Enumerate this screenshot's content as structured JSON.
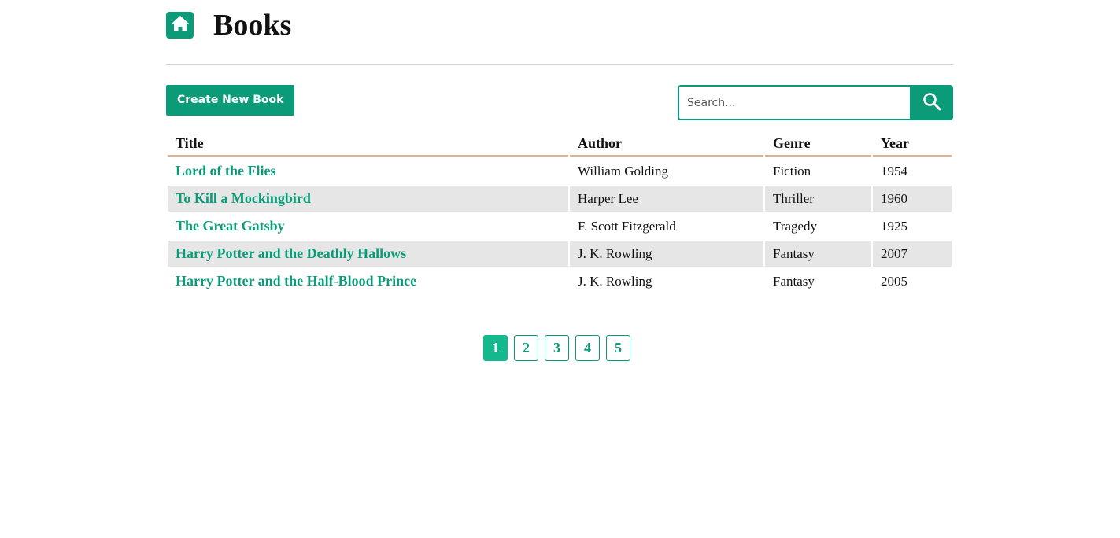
{
  "header": {
    "title": "Books",
    "home_icon": "home-icon"
  },
  "toolbar": {
    "create_label": "Create New Book",
    "search_placeholder": "Search...",
    "search_value": "",
    "search_icon": "search-icon"
  },
  "colors": {
    "accent": "#0b9b78",
    "active_page": "#13b88d",
    "header_underline": "#e0b48a",
    "stripe": "#e6e6e6"
  },
  "table": {
    "columns": [
      "Title",
      "Author",
      "Genre",
      "Year"
    ],
    "rows": [
      {
        "title": "Lord of the Flies",
        "author": "William Golding",
        "genre": "Fiction",
        "year": "1954"
      },
      {
        "title": "To Kill a Mockingbird",
        "author": "Harper Lee",
        "genre": "Thriller",
        "year": "1960"
      },
      {
        "title": "The Great Gatsby",
        "author": "F. Scott Fitzgerald",
        "genre": "Tragedy",
        "year": "1925"
      },
      {
        "title": "Harry Potter and the Deathly Hallows",
        "author": "J. K. Rowling",
        "genre": "Fantasy",
        "year": "2007"
      },
      {
        "title": "Harry Potter and the Half-Blood Prince",
        "author": "J. K. Rowling",
        "genre": "Fantasy",
        "year": "2005"
      }
    ]
  },
  "pagination": {
    "pages": [
      "1",
      "2",
      "3",
      "4",
      "5"
    ],
    "current": "1"
  }
}
